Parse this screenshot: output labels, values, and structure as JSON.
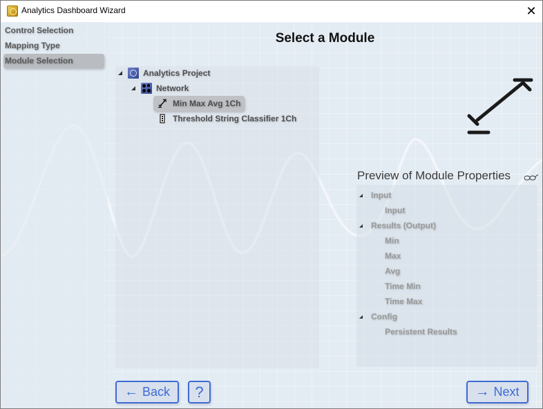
{
  "window": {
    "title": "Analytics Dashboard Wizard",
    "close_label": "✕"
  },
  "sidebar": {
    "items": [
      {
        "label": "Control Selection",
        "active": false
      },
      {
        "label": "Mapping Type",
        "active": false
      },
      {
        "label": "Module Selection",
        "active": true
      }
    ]
  },
  "main": {
    "title": "Select a Module",
    "tree": {
      "root": {
        "label": "Analytics Project",
        "icon": "analytics-project-icon",
        "expanded": true
      },
      "network": {
        "label": "Network",
        "icon": "network-icon",
        "expanded": true
      },
      "modules": [
        {
          "label": "Min Max Avg 1Ch",
          "icon": "min-max-avg-icon",
          "selected": true
        },
        {
          "label": "Threshold String Classifier 1Ch",
          "icon": "threshold-classifier-icon",
          "selected": false
        }
      ]
    },
    "selected_module_icon": "min-max-avg-icon"
  },
  "preview": {
    "header": "Preview of Module Properties",
    "header_icon": "glasses-icon",
    "groups": [
      {
        "label": "Input",
        "children": [
          "Input"
        ]
      },
      {
        "label": "Results (Output)",
        "children": [
          "Min",
          "Max",
          "Avg",
          "Time Min",
          "Time Max"
        ]
      },
      {
        "label": "Config",
        "children": [
          "Persistent Results"
        ]
      }
    ]
  },
  "footer": {
    "back_label": "Back",
    "back_arrow": "←",
    "help_label": "?",
    "next_label": "Next",
    "next_arrow": "→"
  },
  "colors": {
    "accent": "#3d6ad6",
    "background": "#e3ebf3",
    "selection": "#bfc1c4"
  }
}
